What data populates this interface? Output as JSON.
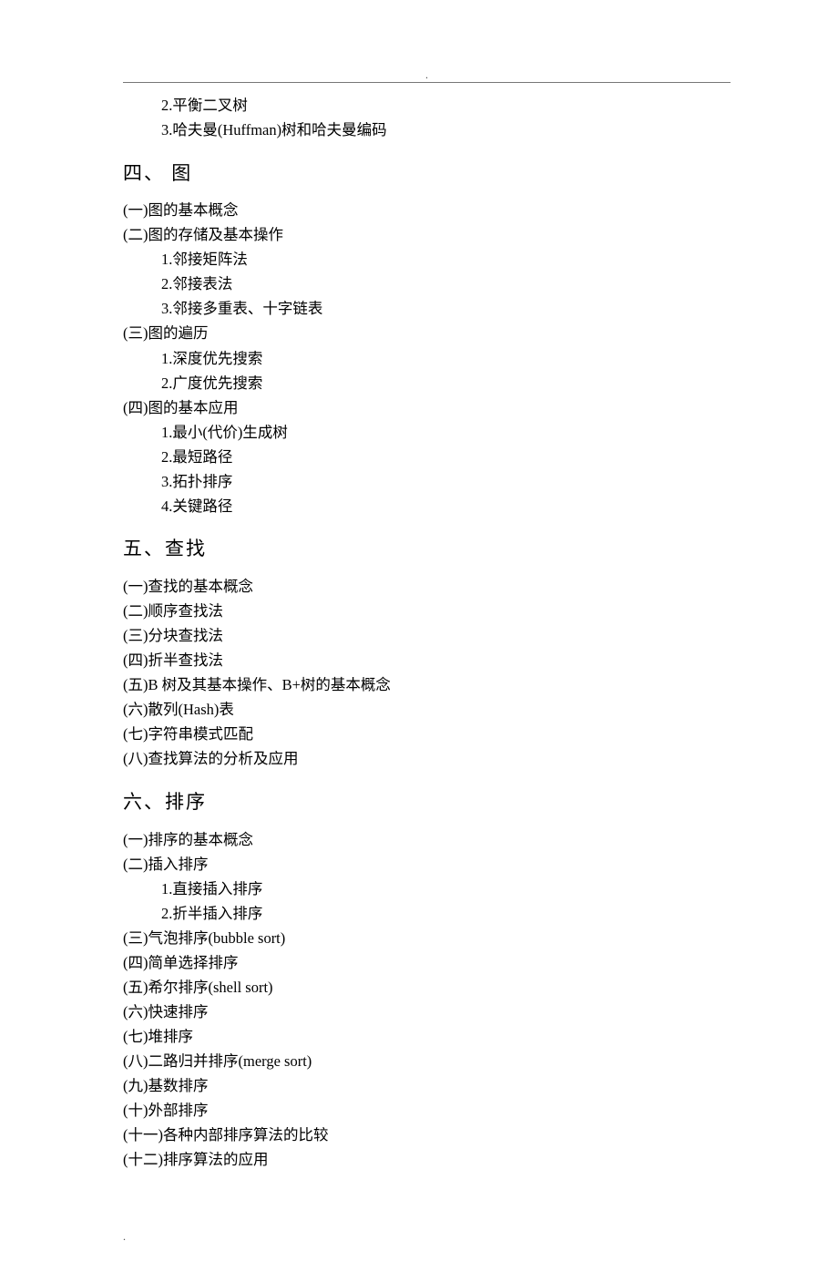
{
  "intro_sub": [
    "2.平衡二叉树",
    "3.哈夫曼(Huffman)树和哈夫曼编码"
  ],
  "section4": {
    "title": "四、 图",
    "items": [
      {
        "t": "(一)图的基本概念",
        "sub": []
      },
      {
        "t": "(二)图的存储及基本操作",
        "sub": [
          "1.邻接矩阵法",
          "2.邻接表法",
          "3.邻接多重表、十字链表"
        ]
      },
      {
        "t": "(三)图的遍历",
        "sub": [
          "1.深度优先搜索",
          "2.广度优先搜索"
        ]
      },
      {
        "t": "(四)图的基本应用",
        "sub": [
          "1.最小(代价)生成树",
          "2.最短路径",
          "3.拓扑排序",
          "4.关键路径"
        ]
      }
    ]
  },
  "section5": {
    "title": "五、查找",
    "items": [
      {
        "t": "(一)查找的基本概念",
        "sub": []
      },
      {
        "t": "(二)顺序查找法",
        "sub": []
      },
      {
        "t": "(三)分块查找法",
        "sub": []
      },
      {
        "t": "(四)折半查找法",
        "sub": []
      },
      {
        "t": "(五)B 树及其基本操作、B+树的基本概念",
        "sub": []
      },
      {
        "t": "(六)散列(Hash)表",
        "sub": []
      },
      {
        "t": "(七)字符串模式匹配",
        "sub": []
      },
      {
        "t": "(八)查找算法的分析及应用",
        "sub": []
      }
    ]
  },
  "section6": {
    "title": "六、排序",
    "items": [
      {
        "t": "(一)排序的基本概念",
        "sub": []
      },
      {
        "t": "(二)插入排序",
        "sub": [
          "1.直接插入排序",
          "2.折半插入排序"
        ]
      },
      {
        "t": "(三)气泡排序(bubble sort)",
        "sub": []
      },
      {
        "t": "(四)简单选择排序",
        "sub": []
      },
      {
        "t": "(五)希尔排序(shell sort)",
        "sub": []
      },
      {
        "t": "(六)快速排序",
        "sub": []
      },
      {
        "t": "(七)堆排序",
        "sub": []
      },
      {
        "t": "(八)二路归并排序(merge sort)",
        "sub": []
      },
      {
        "t": "(九)基数排序",
        "sub": []
      },
      {
        "t": "(十)外部排序",
        "sub": []
      },
      {
        "t": "(十一)各种内部排序算法的比较",
        "sub": []
      },
      {
        "t": "(十二)排序算法的应用",
        "sub": []
      }
    ]
  },
  "footer_dot": "."
}
